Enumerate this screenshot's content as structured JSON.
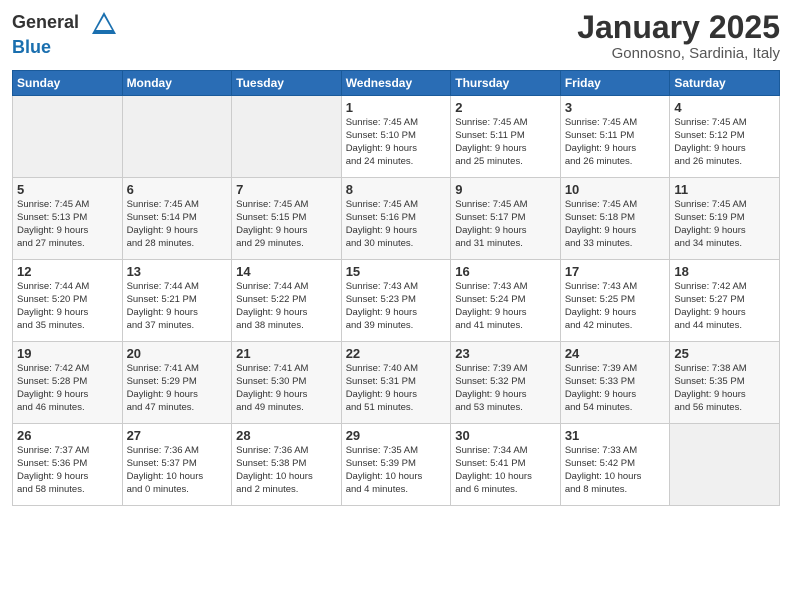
{
  "header": {
    "logo_general": "General",
    "logo_blue": "Blue",
    "month_title": "January 2025",
    "subtitle": "Gonnosno, Sardinia, Italy"
  },
  "weekdays": [
    "Sunday",
    "Monday",
    "Tuesday",
    "Wednesday",
    "Thursday",
    "Friday",
    "Saturday"
  ],
  "weeks": [
    [
      {
        "day": "",
        "info": ""
      },
      {
        "day": "",
        "info": ""
      },
      {
        "day": "",
        "info": ""
      },
      {
        "day": "1",
        "info": "Sunrise: 7:45 AM\nSunset: 5:10 PM\nDaylight: 9 hours\nand 24 minutes."
      },
      {
        "day": "2",
        "info": "Sunrise: 7:45 AM\nSunset: 5:11 PM\nDaylight: 9 hours\nand 25 minutes."
      },
      {
        "day": "3",
        "info": "Sunrise: 7:45 AM\nSunset: 5:11 PM\nDaylight: 9 hours\nand 26 minutes."
      },
      {
        "day": "4",
        "info": "Sunrise: 7:45 AM\nSunset: 5:12 PM\nDaylight: 9 hours\nand 26 minutes."
      }
    ],
    [
      {
        "day": "5",
        "info": "Sunrise: 7:45 AM\nSunset: 5:13 PM\nDaylight: 9 hours\nand 27 minutes."
      },
      {
        "day": "6",
        "info": "Sunrise: 7:45 AM\nSunset: 5:14 PM\nDaylight: 9 hours\nand 28 minutes."
      },
      {
        "day": "7",
        "info": "Sunrise: 7:45 AM\nSunset: 5:15 PM\nDaylight: 9 hours\nand 29 minutes."
      },
      {
        "day": "8",
        "info": "Sunrise: 7:45 AM\nSunset: 5:16 PM\nDaylight: 9 hours\nand 30 minutes."
      },
      {
        "day": "9",
        "info": "Sunrise: 7:45 AM\nSunset: 5:17 PM\nDaylight: 9 hours\nand 31 minutes."
      },
      {
        "day": "10",
        "info": "Sunrise: 7:45 AM\nSunset: 5:18 PM\nDaylight: 9 hours\nand 33 minutes."
      },
      {
        "day": "11",
        "info": "Sunrise: 7:45 AM\nSunset: 5:19 PM\nDaylight: 9 hours\nand 34 minutes."
      }
    ],
    [
      {
        "day": "12",
        "info": "Sunrise: 7:44 AM\nSunset: 5:20 PM\nDaylight: 9 hours\nand 35 minutes."
      },
      {
        "day": "13",
        "info": "Sunrise: 7:44 AM\nSunset: 5:21 PM\nDaylight: 9 hours\nand 37 minutes."
      },
      {
        "day": "14",
        "info": "Sunrise: 7:44 AM\nSunset: 5:22 PM\nDaylight: 9 hours\nand 38 minutes."
      },
      {
        "day": "15",
        "info": "Sunrise: 7:43 AM\nSunset: 5:23 PM\nDaylight: 9 hours\nand 39 minutes."
      },
      {
        "day": "16",
        "info": "Sunrise: 7:43 AM\nSunset: 5:24 PM\nDaylight: 9 hours\nand 41 minutes."
      },
      {
        "day": "17",
        "info": "Sunrise: 7:43 AM\nSunset: 5:25 PM\nDaylight: 9 hours\nand 42 minutes."
      },
      {
        "day": "18",
        "info": "Sunrise: 7:42 AM\nSunset: 5:27 PM\nDaylight: 9 hours\nand 44 minutes."
      }
    ],
    [
      {
        "day": "19",
        "info": "Sunrise: 7:42 AM\nSunset: 5:28 PM\nDaylight: 9 hours\nand 46 minutes."
      },
      {
        "day": "20",
        "info": "Sunrise: 7:41 AM\nSunset: 5:29 PM\nDaylight: 9 hours\nand 47 minutes."
      },
      {
        "day": "21",
        "info": "Sunrise: 7:41 AM\nSunset: 5:30 PM\nDaylight: 9 hours\nand 49 minutes."
      },
      {
        "day": "22",
        "info": "Sunrise: 7:40 AM\nSunset: 5:31 PM\nDaylight: 9 hours\nand 51 minutes."
      },
      {
        "day": "23",
        "info": "Sunrise: 7:39 AM\nSunset: 5:32 PM\nDaylight: 9 hours\nand 53 minutes."
      },
      {
        "day": "24",
        "info": "Sunrise: 7:39 AM\nSunset: 5:33 PM\nDaylight: 9 hours\nand 54 minutes."
      },
      {
        "day": "25",
        "info": "Sunrise: 7:38 AM\nSunset: 5:35 PM\nDaylight: 9 hours\nand 56 minutes."
      }
    ],
    [
      {
        "day": "26",
        "info": "Sunrise: 7:37 AM\nSunset: 5:36 PM\nDaylight: 9 hours\nand 58 minutes."
      },
      {
        "day": "27",
        "info": "Sunrise: 7:36 AM\nSunset: 5:37 PM\nDaylight: 10 hours\nand 0 minutes."
      },
      {
        "day": "28",
        "info": "Sunrise: 7:36 AM\nSunset: 5:38 PM\nDaylight: 10 hours\nand 2 minutes."
      },
      {
        "day": "29",
        "info": "Sunrise: 7:35 AM\nSunset: 5:39 PM\nDaylight: 10 hours\nand 4 minutes."
      },
      {
        "day": "30",
        "info": "Sunrise: 7:34 AM\nSunset: 5:41 PM\nDaylight: 10 hours\nand 6 minutes."
      },
      {
        "day": "31",
        "info": "Sunrise: 7:33 AM\nSunset: 5:42 PM\nDaylight: 10 hours\nand 8 minutes."
      },
      {
        "day": "",
        "info": ""
      }
    ]
  ]
}
